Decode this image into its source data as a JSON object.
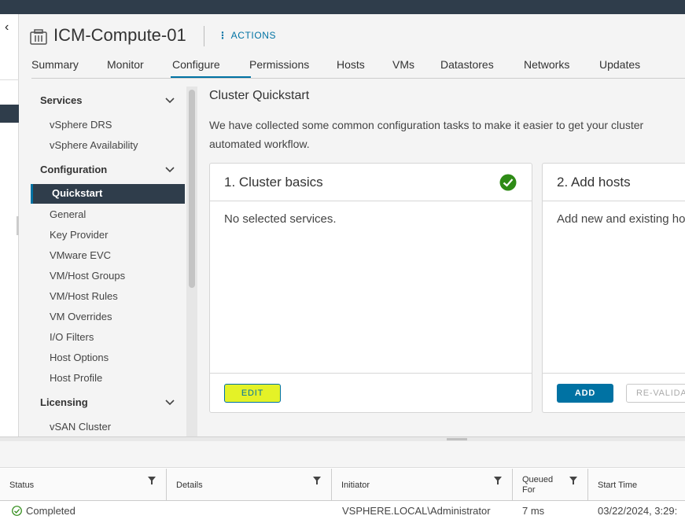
{
  "header": {
    "title": "ICM-Compute-01",
    "actions_label": "ACTIONS",
    "tabs": [
      {
        "label": "Summary",
        "active": false
      },
      {
        "label": "Monitor",
        "active": false
      },
      {
        "label": "Configure",
        "active": true
      },
      {
        "label": "Permissions",
        "active": false
      },
      {
        "label": "Hosts",
        "active": false
      },
      {
        "label": "VMs",
        "active": false
      },
      {
        "label": "Datastores",
        "active": false
      },
      {
        "label": "Networks",
        "active": false
      },
      {
        "label": "Updates",
        "active": false
      }
    ]
  },
  "menu": {
    "services": {
      "title": "Services",
      "items": [
        "vSphere DRS",
        "vSphere Availability"
      ]
    },
    "configuration": {
      "title": "Configuration",
      "items": [
        "Quickstart",
        "General",
        "Key Provider",
        "VMware EVC",
        "VM/Host Groups",
        "VM/Host Rules",
        "VM Overrides",
        "I/O Filters",
        "Host Options",
        "Host Profile"
      ]
    },
    "licensing": {
      "title": "Licensing",
      "items": [
        "vSAN Cluster"
      ]
    }
  },
  "quickstart": {
    "title": "Cluster Quickstart",
    "description": "We have collected some common configuration tasks to make it easier to get your cluster automated workflow.",
    "cards": [
      {
        "title": "1. Cluster basics",
        "body": "No selected services.",
        "button": "EDIT",
        "status": "complete"
      },
      {
        "title": "2. Add hosts",
        "body": "Add new and existing ho",
        "button": "ADD",
        "secondary_button": "RE-VALIDA"
      }
    ]
  },
  "tasks": {
    "columns": [
      "Status",
      "Details",
      "Initiator",
      "Queued For",
      "Start Time"
    ],
    "rows": [
      {
        "status": "Completed",
        "details": "",
        "initiator": "VSPHERE.LOCAL\\Administrator",
        "queued_for": "7 ms",
        "start_time": "03/22/2024, 3:29:"
      }
    ]
  },
  "colors": {
    "accent": "#0072a3",
    "nav_dark": "#2f3d4b",
    "success": "#2e8b16",
    "highlight": "#e4f227"
  }
}
